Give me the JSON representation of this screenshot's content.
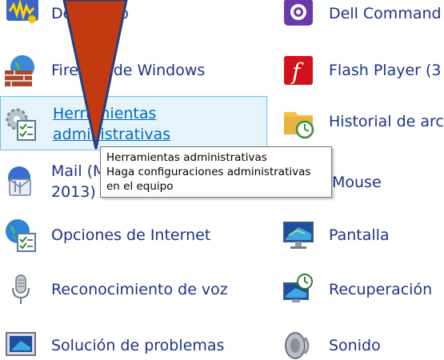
{
  "items": {
    "dell_audio": {
      "label": "Dell Audio"
    },
    "dell_command": {
      "label": "Dell Command"
    },
    "firewall": {
      "label": "Firewall de Windows"
    },
    "flash": {
      "label": "Flash Player (3"
    },
    "admin_tools": {
      "label_line1": "Herramientas",
      "label_line2": "administrativas"
    },
    "history": {
      "label": "Historial de arc"
    },
    "mail": {
      "label_line1": "Mail (M",
      "label_line2": "2013)"
    },
    "mouse": {
      "label": "Mouse"
    },
    "internet": {
      "label": "Opciones de Internet"
    },
    "display": {
      "label": "Pantalla"
    },
    "voice": {
      "label": "Reconocimiento de voz"
    },
    "recovery": {
      "label": "Recuperación"
    },
    "troubleshoot": {
      "label": "Solución de problemas"
    },
    "sound": {
      "label": "Sonido"
    }
  },
  "tooltip": {
    "line1": "Herramientas administrativas",
    "line2": "Haga configuraciones administrativas",
    "line3": "en el equipo"
  },
  "colors": {
    "link_text": "#1e3287",
    "hover_link": "#006ac1",
    "hover_bg": "#e5f3fb",
    "hover_border": "#70c0e7",
    "arrow_fill": "#c43a10"
  }
}
